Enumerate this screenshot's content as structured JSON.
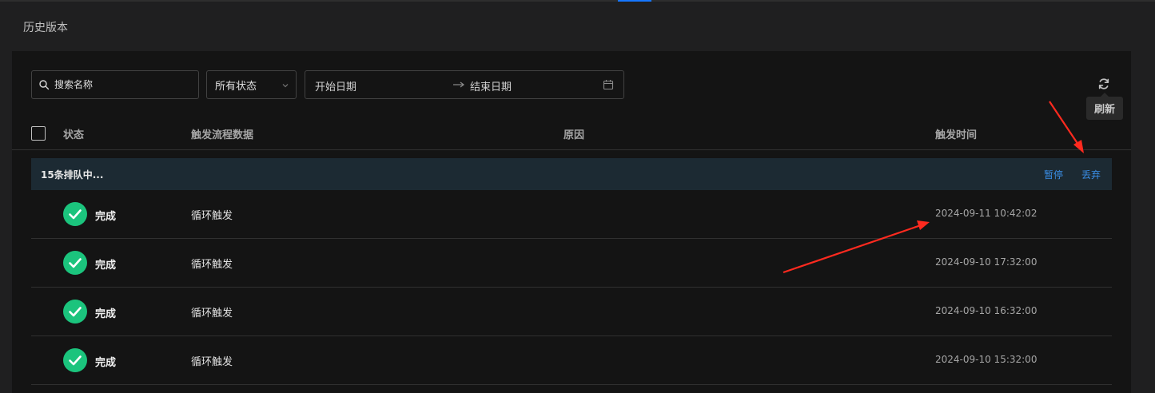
{
  "page": {
    "title": "历史版本"
  },
  "toolbar": {
    "search_placeholder": "搜索名称",
    "status_select": "所有状态",
    "date_start": "开始日期",
    "date_end": "结束日期",
    "refresh_tooltip": "刷新"
  },
  "table": {
    "headers": {
      "status": "状态",
      "trigger_data": "触发流程数据",
      "reason": "原因",
      "trigger_time": "触发时间"
    },
    "queue": {
      "text": "15条排队中...",
      "pause": "暂停",
      "discard": "丢弃"
    },
    "rows": [
      {
        "status": "完成",
        "trigger": "循环触发",
        "reason": "",
        "time": "2024-09-11 10:42:02"
      },
      {
        "status": "完成",
        "trigger": "循环触发",
        "reason": "",
        "time": "2024-09-10 17:32:00"
      },
      {
        "status": "完成",
        "trigger": "循环触发",
        "reason": "",
        "time": "2024-09-10 16:32:00"
      },
      {
        "status": "完成",
        "trigger": "循环触发",
        "reason": "",
        "time": "2024-09-10 15:32:00"
      }
    ]
  },
  "colors": {
    "success": "#1bc47d",
    "link": "#3a8ee6",
    "annotation": "#ff2a1f"
  },
  "icons": {
    "check": "check-circle-icon",
    "search": "search-icon",
    "refresh": "refresh-icon",
    "calendar": "calendar-icon"
  }
}
